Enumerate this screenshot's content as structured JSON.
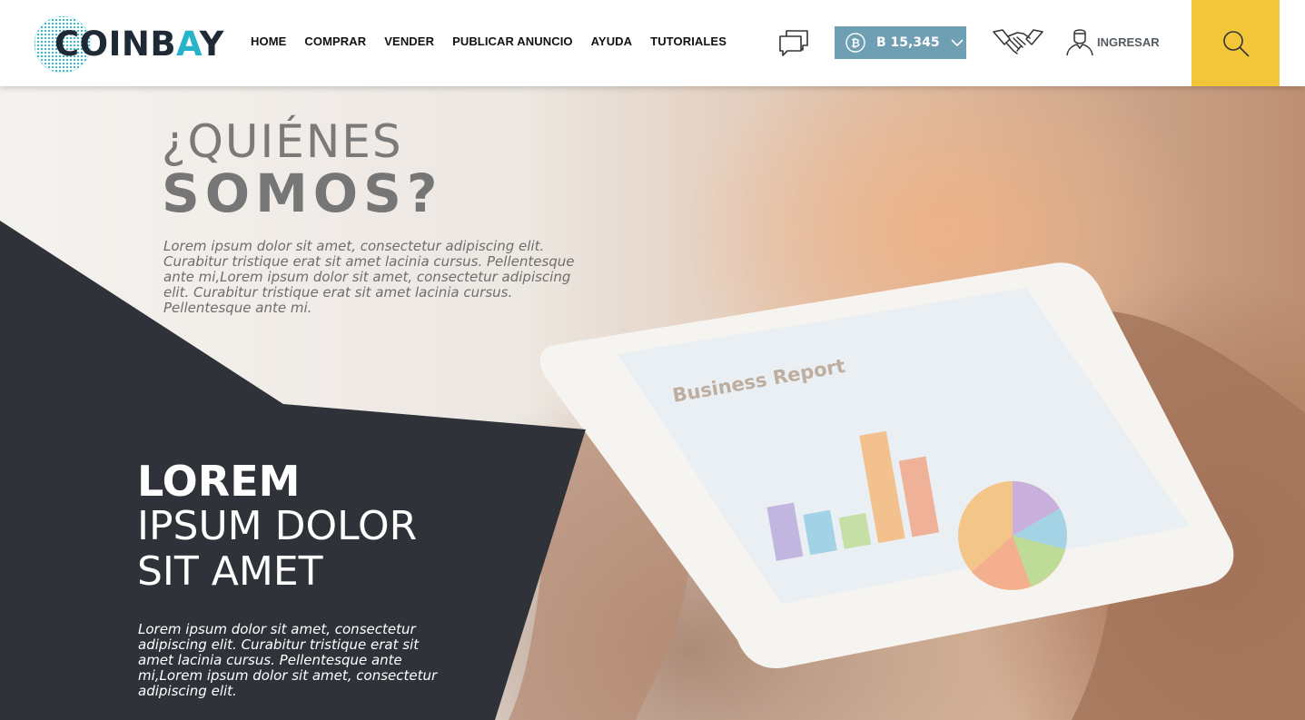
{
  "brand": {
    "logo_text_left": "COINB",
    "logo_text_accent": "A",
    "logo_text_right": "Y"
  },
  "nav": {
    "items": [
      {
        "label": "HOME"
      },
      {
        "label": "COMPRAR"
      },
      {
        "label": "VENDER"
      },
      {
        "label": "PUBLICAR ANUNCIO"
      },
      {
        "label": "AYUDA"
      },
      {
        "label": "TUTORIALES"
      }
    ]
  },
  "header": {
    "btc_value": "B 15,345",
    "login_label": "INGRESAR",
    "icons": [
      "chat-icon",
      "bitcoin-icon",
      "chevron-down-icon",
      "handshake-icon",
      "user-icon",
      "search-icon"
    ]
  },
  "hero": {
    "title_line1": "¿QUIÉNES",
    "title_line2": "SOMOS?",
    "intro": "Lorem ipsum dolor sit amet, consectetur adipiscing elit. Curabitur tristique erat sit amet lacinia cursus. Pellentesque ante mi,Lorem ipsum dolor sit amet, consectetur adipiscing elit. Curabitur tristique erat sit amet lacinia cursus. Pellentesque ante mi.",
    "heading_bold": "LOREM",
    "heading_line2": "IPSUM DOLOR",
    "heading_line3": "SIT AMET",
    "body": "Lorem ipsum dolor sit amet, consectetur adipiscing elit. Curabitur tristique erat sit amet lacinia cursus. Pellentesque ante mi,Lorem ipsum dolor sit amet, consectetur adipiscing elit.",
    "tablet_report_title": "Business Report"
  },
  "colors": {
    "accent_teal": "#27b3c8",
    "btc_box": "#6e9fb3",
    "search_yellow": "#f3c63a",
    "dark_panel": "#2f3339"
  }
}
